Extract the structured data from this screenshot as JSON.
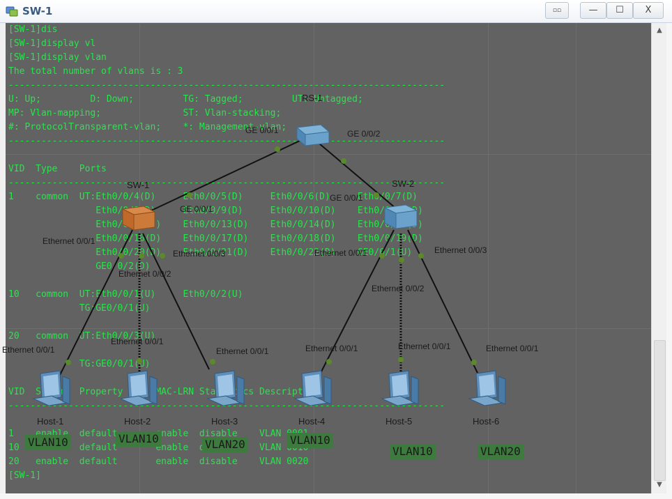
{
  "window": {
    "title": "SW-1",
    "buttons": {
      "restore_label": "▫▫",
      "minimize_label": "—",
      "maximize_label": "☐",
      "close_label": "X"
    }
  },
  "terminal": {
    "lines": [
      "[SW-1]dis",
      "[SW-1]display vl",
      "[SW-1]display vlan",
      "The total number of vlans is : 3",
      "--------------------------------------------------------------------------------",
      "U: Up;         D: Down;         TG: Tagged;         UT: Untagged;",
      "MP: Vlan-mapping;               ST: Vlan-stacking;",
      "#: ProtocolTransparent-vlan;    *: Management-vlan;",
      "--------------------------------------------------------------------------------",
      "",
      "VID  Type    Ports",
      "--------------------------------------------------------------------------------",
      "1    common  UT:Eth0/0/4(D)     Eth0/0/5(D)     Eth0/0/6(D)     Eth0/0/7(D)",
      "                Eth0/0/8(D)     Eth0/0/9(D)     Eth0/0/10(D)    Eth0/0/11(D)",
      "                Eth0/0/12(D)    Eth0/0/13(D)    Eth0/0/14(D)    Eth0/0/15(D)",
      "                Eth0/0/16(D)    Eth0/0/17(D)    Eth0/0/18(D)    Eth0/0/19(D)",
      "                Eth0/0/20(D)    Eth0/0/21(D)    Eth0/0/22(D)    GE0/0/1(U)",
      "                GE0/0/2(D)",
      "",
      "10   common  UT:Eth0/0/1(U)     Eth0/0/2(U)",
      "             TG:GE0/0/1(U)",
      "",
      "20   common  UT:Eth0/0/3(U)",
      "",
      "             TG:GE0/0/1(U)",
      "",
      "VID  Status  Property      MAC-LRN Statistics Description",
      "--------------------------------------------------------------------------------",
      "",
      "1    enable  default       enable  disable    VLAN 0001",
      "10   enable  default       enable  disable    VLAN 0010",
      "20   enable  default       enable  disable    VLAN 0020",
      "[SW-1]"
    ]
  },
  "topology": {
    "devices": {
      "rs1": "RS-1",
      "sw1": "SW-1",
      "sw2": "SW-2",
      "hosts": [
        "Host-1",
        "Host-2",
        "Host-3",
        "Host-4",
        "Host-5",
        "Host-6"
      ]
    },
    "port_labels": {
      "rs1_ge1": "GE 0/0/1",
      "rs1_ge2": "GE 0/0/2",
      "sw1_ge1": "GE 0/0/1",
      "sw2_ge1": "GE 0/0/1",
      "sw1_e1": "Ethernet 0/0/1",
      "sw1_e2": "Ethernet 0/0/2",
      "sw1_e3": "Ethernet 0/0/3",
      "sw2_e1": "Ethernet 0/0/1",
      "sw2_e2": "Ethernet 0/0/2",
      "sw2_e3": "Ethernet 0/0/3",
      "h1_e1": "Ethernet 0/0/1",
      "h2_e1": "Ethernet 0/0/1",
      "h3_e1": "Ethernet 0/0/1",
      "h4_e1": "Ethernet 0/0/1",
      "h5_e1": "Ethernet 0/0/1",
      "h6_e1": "Ethernet 0/0/1"
    },
    "vlan_tags": [
      "VLAN10",
      "VLAN10",
      "VLAN20",
      "VLAN10",
      "VLAN10",
      "VLAN20"
    ],
    "colors": {
      "terminal_bg": "#626262",
      "terminal_text": "#29e44c",
      "link": "#111111",
      "port_dot": "#5a8a2a",
      "vlan_tag_bg": "#3d7a3d"
    }
  }
}
